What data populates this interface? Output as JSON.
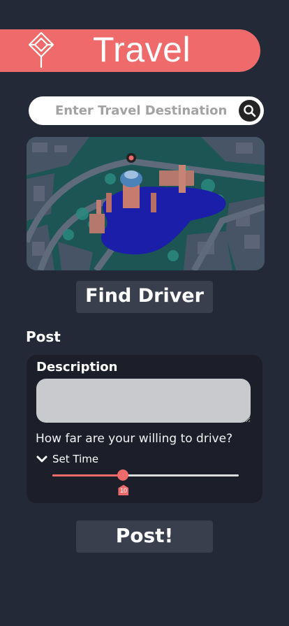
{
  "header": {
    "title": "Travel",
    "logo_icon": "diamond-logo-icon",
    "color": "#ef6b6b"
  },
  "search": {
    "placeholder": "Enter Travel Destination",
    "value": "",
    "icon": "search-icon"
  },
  "map": {
    "description_icon": "map-3d-view"
  },
  "find_driver": {
    "label": "Find Driver"
  },
  "post_section": {
    "title": "Post",
    "description_label": "Description",
    "description_value": "",
    "question": "How far are your willing to drive?",
    "set_time_label": "Set Time",
    "slider": {
      "value": 10,
      "fraction": 0.38,
      "value_label": "10"
    }
  },
  "post_button": {
    "label": "Post!"
  },
  "colors": {
    "background": "#242938",
    "accent": "#ef6b6b",
    "card": "#1c1f2a",
    "button": "#393f4d"
  }
}
